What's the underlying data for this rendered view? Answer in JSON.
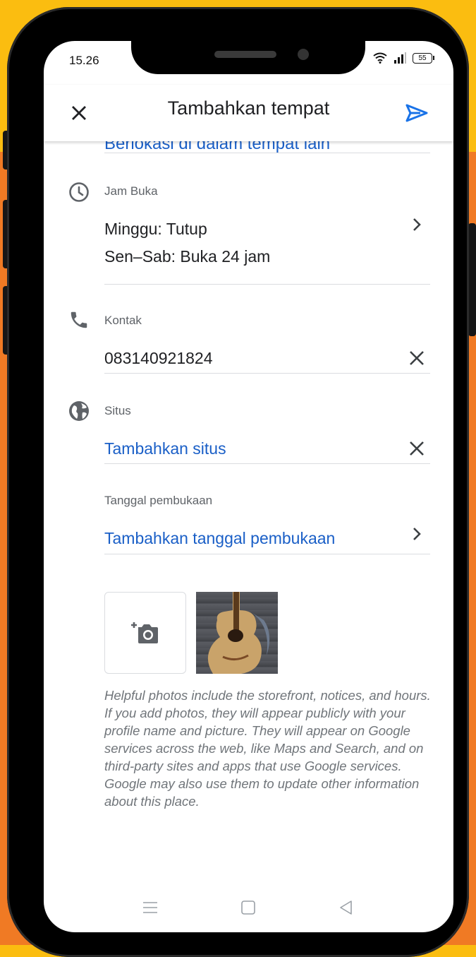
{
  "status_bar": {
    "time": "15.26",
    "battery": "55"
  },
  "app_bar": {
    "title": "Tambahkan tempat"
  },
  "cut_off_row": {
    "text": "Berlokasi di dalam tempat lain"
  },
  "hours": {
    "label": "Jam Buka",
    "line1": "Minggu: Tutup",
    "line2": "Sen–Sab: Buka 24 jam"
  },
  "contact": {
    "label": "Kontak",
    "value": "083140921824"
  },
  "website": {
    "label": "Situs",
    "value": "Tambahkan situs"
  },
  "opening_date": {
    "label": "Tanggal pembukaan",
    "value": "Tambahkan tanggal pembukaan"
  },
  "photos": {
    "disclaimer": "Helpful photos include the storefront, notices, and hours. If you add photos, they will appear publicly with your profile name and picture. They will appear on Google services across the web, like Maps and Search, and on third-party sites and apps that use Google services. Google may also use them to update other information about this place."
  },
  "colors": {
    "accent": "#1a73e8",
    "link": "#1a5fc7",
    "bg_top": "#fbbd10",
    "bg_bottom": "#f07a24"
  },
  "icons": [
    "close-icon",
    "send-icon",
    "clock-icon",
    "phone-icon",
    "globe-icon",
    "chevron-right-icon",
    "clear-icon",
    "add-photo-icon",
    "nav-menu-icon",
    "nav-home-icon",
    "nav-back-icon"
  ]
}
